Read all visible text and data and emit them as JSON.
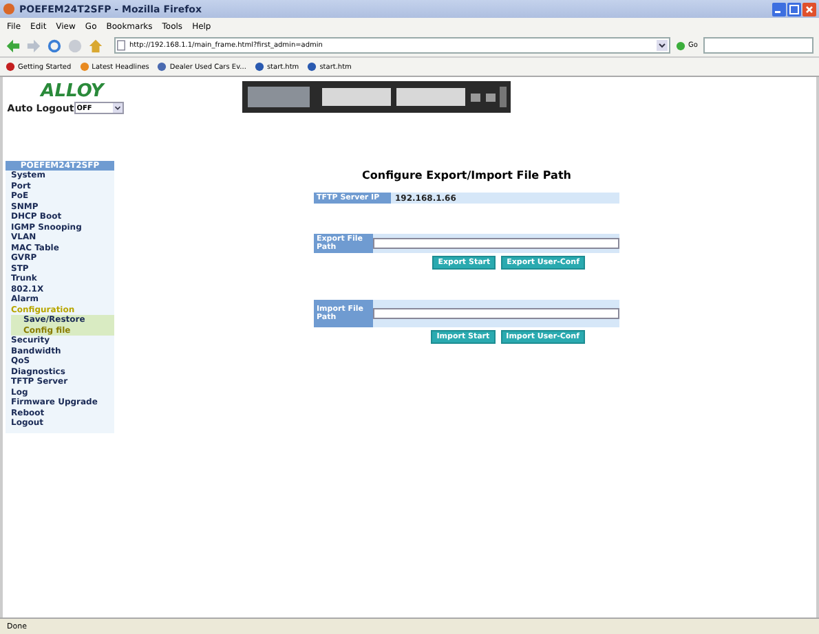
{
  "window": {
    "title": "POEFEM24T2SFP - Mozilla Firefox"
  },
  "menu": [
    "File",
    "Edit",
    "View",
    "Go",
    "Bookmarks",
    "Tools",
    "Help"
  ],
  "address": {
    "value": "http://192.168.1.1/main_frame.html?first_admin=admin",
    "go": "Go"
  },
  "bookmarks": [
    "Getting Started",
    "Latest Headlines",
    "Dealer Used Cars Ev...",
    "start.htm",
    "start.htm"
  ],
  "header": {
    "logo": "ALLOY",
    "auto_logout_label": "Auto Logout",
    "auto_logout_value": "OFF"
  },
  "sidebar": {
    "title": "POEFEM24T2SFP",
    "items": [
      {
        "label": "System",
        "selected": false
      },
      {
        "label": "Port",
        "selected": false
      },
      {
        "label": "PoE",
        "selected": false
      },
      {
        "label": "SNMP",
        "selected": false
      },
      {
        "label": "DHCP Boot",
        "selected": false
      },
      {
        "label": "IGMP Snooping",
        "selected": false
      },
      {
        "label": "VLAN",
        "selected": false
      },
      {
        "label": "MAC Table",
        "selected": false
      },
      {
        "label": "GVRP",
        "selected": false
      },
      {
        "label": "STP",
        "selected": false
      },
      {
        "label": "Trunk",
        "selected": false
      },
      {
        "label": "802.1X",
        "selected": false
      },
      {
        "label": "Alarm",
        "selected": false
      },
      {
        "label": "Configuration",
        "selected": true,
        "expanded": true,
        "children": [
          {
            "label": "Save/Restore",
            "selected": false
          },
          {
            "label": "Config file",
            "selected": true
          }
        ]
      },
      {
        "label": "Security",
        "selected": false
      },
      {
        "label": "Bandwidth",
        "selected": false
      },
      {
        "label": "QoS",
        "selected": false
      },
      {
        "label": "Diagnostics",
        "selected": false
      },
      {
        "label": "TFTP Server",
        "selected": false
      },
      {
        "label": "Log",
        "selected": false
      },
      {
        "label": "Firmware Upgrade",
        "selected": false
      },
      {
        "label": "Reboot",
        "selected": false
      },
      {
        "label": "Logout",
        "selected": false
      }
    ]
  },
  "main": {
    "title": "Configure Export/Import File Path",
    "server": {
      "label": "TFTP Server IP",
      "value": "192.168.1.66"
    },
    "export": {
      "label": "Export File Path",
      "buttons": [
        "Export Start",
        "Export User-Conf"
      ]
    },
    "import": {
      "label": "Import File Path",
      "buttons": [
        "Import Start",
        "Import User-Conf"
      ]
    }
  },
  "status_bar": "Done"
}
